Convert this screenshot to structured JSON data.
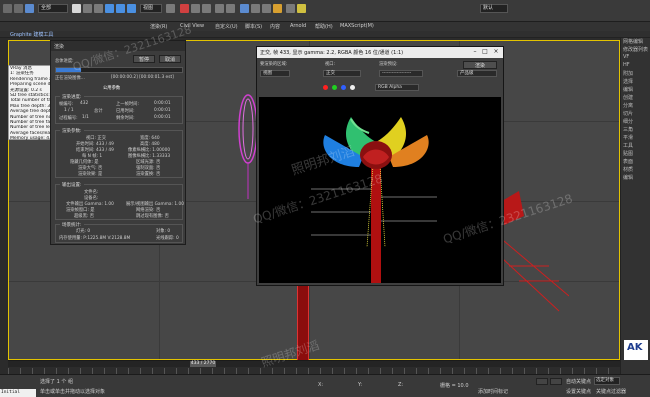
{
  "toolbar": {
    "selection_filter": "全部",
    "view_dropdown": "视图",
    "workspace": "默认",
    "menu_items": [
      "渲染(R)",
      "Civil View",
      "自定义(U)",
      "脚本(S)",
      "内容",
      "Arnold",
      "帮助(H)",
      "MAXScript(M)"
    ],
    "tab": "Graphite 建模工具"
  },
  "scene_list": {
    "rows": [
      "VRay 消息",
      "1: 渲染任务",
      "Rendering frame at time",
      "Preparing scene data",
      "光源设置: 0.2 s",
      "SD tree statistics:",
      "Total number of faces",
      "Max tree depth: 36",
      "Average tree depth: 25",
      "Number of tree nodes",
      "Number of tree faces",
      "Number of tree leafs",
      "Average faces/leaf",
      "Memory usage: 4.13 MB",
      "Building: Done in 0.0 s"
    ]
  },
  "render_dialog": {
    "title": "渲染",
    "pause_button": "暂停",
    "cancel_button": "取消",
    "label_progress": "总体进度:",
    "status": "正在渲染图像...",
    "time_info": "[00:00:00.2] [00:00:01.3 est]",
    "group_params_title": "公用参数",
    "group_render_progress": "渲染进度:",
    "frame_label": "帧编号:",
    "frame_value": "432",
    "frames_label": "1 / 1",
    "prev_frame_label": "上一帧时间:",
    "prev_frame_value": "0:00:01",
    "total_label": "总计",
    "passes_label": "过程编号:",
    "passes_value": "1/1",
    "elapsed_label": "已用时间:",
    "elapsed_value": "0:00:01",
    "remain_label": "剩余时间:",
    "remain_value": "0:00:01",
    "group_render_params": "渲染参数:",
    "viewport_label": "视口: 正交",
    "width_label": "宽度: 640",
    "output_width": "开始时间: 433 / 49",
    "output_height": "高度: 480",
    "end_label": "结束时间: 433 / 49",
    "pixel_aspect": "像素纵横比: 1.00000",
    "nth_frame": "每 N 帧: 1",
    "image_aspect": "图像纵横比: 1.33333",
    "hidden_geom": "隐藏几何体: 是",
    "render_atmos": "渲染大气: 否",
    "area_lights": "区域光源: 否",
    "displacement": "强制双面: 否",
    "effects": "渲染效果: 是",
    "force2side": "渲染置换: 否",
    "video_check": "视频颜色检查: 否",
    "fields": "渲染为场: 否",
    "super_black": "超级黑: 否",
    "group_output": "输出设置:",
    "file_name_label": "文件名:",
    "device_label": "设备名:",
    "gamma_label": "文件输出 Gamma: 1.00",
    "vfb_label": "渲染帧窗口: 是",
    "vfb_gamma": "展示/视图输出 Gamma: 1.00",
    "vfb_value": "网络渲染: 否",
    "device_value": "跳过现有图像: 否",
    "group_scene": "场景统计:",
    "lights_label": "灯光: 0",
    "objects_label": "对象: 0",
    "faces_label": "面数: 0",
    "memory_label": "内存使用量: P:1225.8M V:2128.8M",
    "shadow_maps": "阴影贴图: 0",
    "ray_traced": "光线跟踪: 0"
  },
  "frame_buffer": {
    "title": "正交, 帧 433, 显示 gamma: 2.2, RGBA 颜色 16 位/通道 (1:1)",
    "area_label": "要渲染的区域:",
    "viewport_label": "视口:",
    "preset_label": "渲染预设:",
    "area_value": "视图",
    "viewport_value": "正交",
    "preset_value": "------------------",
    "render_button": "渲染",
    "product_label": "产品级",
    "channel": "RGB Alpha"
  },
  "timeline": {
    "frame_range": "433 / 2770"
  },
  "status": {
    "selected": "选择了 1 个 组",
    "hint": "单击或单击并拖动以选择对象",
    "maxscript": "Initial Cleanu",
    "x_label": "X:",
    "y_label": "Y:",
    "z_label": "Z:",
    "grid": "栅格 = 10.0",
    "add_key": "添加时间标记",
    "auto_key": "自动关键点",
    "set_key": "设置关键点",
    "selected_obj": "选定对象",
    "key_filter": "关键点过滤器"
  },
  "command_panel": {
    "items": [
      "网格编辑",
      "修改器列表",
      "VF",
      "HF",
      "附加",
      "选择",
      "编辑",
      "创建",
      "分离",
      "切片",
      "细分",
      "三角",
      "平滑",
      "工具",
      "贴图",
      "表面",
      "材质",
      "编辑"
    ]
  },
  "watermark": {
    "line1": "QQ/微信：2321163128",
    "line2": "照明邦刘滔"
  },
  "logo": {
    "text": "AK"
  },
  "colors": {
    "accent": "#e3c300",
    "viewport_bg": "#474747",
    "flower_red": "#b01010",
    "structure_red": "#cc1010"
  }
}
